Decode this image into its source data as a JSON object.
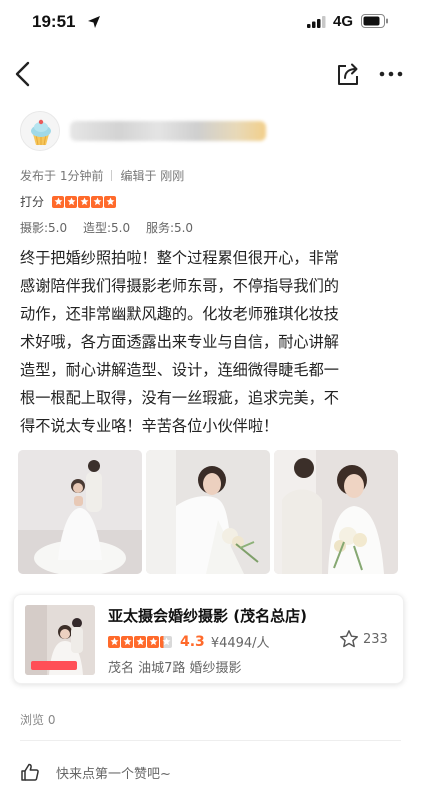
{
  "status_bar": {
    "time": "19:51",
    "network": "4G"
  },
  "nav": {
    "back_icon": "chevron-left-icon",
    "share_icon": "share-icon",
    "more_icon": "more-dots-icon"
  },
  "review": {
    "posted": "发布于 1分钟前",
    "edited": "编辑于 刚刚",
    "score_label": "打分",
    "stars": 5,
    "sub_scores": [
      "摄影:5.0",
      "造型:5.0",
      "服务:5.0"
    ],
    "text_lines": [
      "终于把婚纱照拍啦！整个过程累但很开心，非常",
      "感谢陪伴我们得摄影老师东哥，不停指导我们的",
      "动作，还非常幽默风趣的。化妆老师雅琪化妆技",
      "术好哦，各方面透露出来专业与自信，耐心讲解",
      "造型，耐心讲解造型、设计，连细微得睫毛都一",
      "根一根配上取得，没有一丝瑕疵，追求完美，不",
      "得不说太专业咯！辛苦各位小伙伴啦！"
    ]
  },
  "shop": {
    "name": "亚太摄会婚纱摄影 (茂名总店)",
    "rating": 4.3,
    "rating_text": "4.3",
    "price": "¥4494/人",
    "favorites": "233",
    "location": "茂名 油城7路 婚纱摄影"
  },
  "footer": {
    "views": "浏览 0",
    "like_prompt": "快来点第一个赞吧~"
  },
  "colors": {
    "accent": "#ff6a2b"
  }
}
